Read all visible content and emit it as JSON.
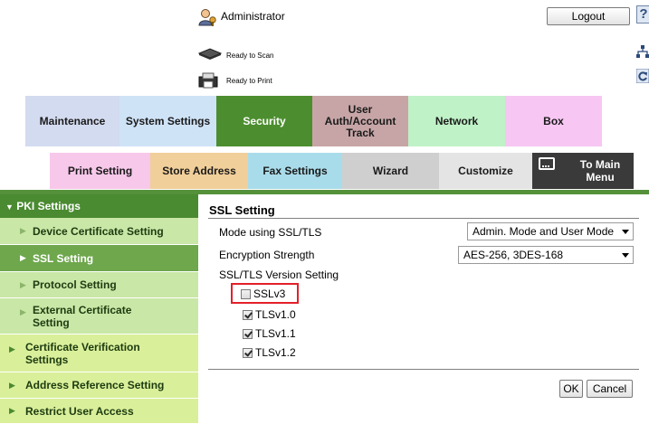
{
  "header": {
    "user_label": "Administrator",
    "logout_label": "Logout",
    "help_glyph": "?",
    "scan_status": "Ready to Scan",
    "print_status": "Ready to Print"
  },
  "main_tabs": [
    {
      "label": "Maintenance",
      "color": "#d3dbf0"
    },
    {
      "label": "System Settings",
      "color": "#cfe3f7"
    },
    {
      "label": "Security",
      "color": "#4c8e2f",
      "selected": true
    },
    {
      "label": "User Auth/Account Track",
      "color": "#c7a5a6"
    },
    {
      "label": "Network",
      "color": "#bff2c7"
    },
    {
      "label": "Box",
      "color": "#f7c6f3"
    }
  ],
  "sub_tabs": [
    {
      "label": "Print Setting",
      "color": "#f7c8ea"
    },
    {
      "label": "Store Address",
      "color": "#f1cf9a"
    },
    {
      "label": "Fax Settings",
      "color": "#a9dcea"
    },
    {
      "label": "Wizard",
      "color": "#cfcfcf"
    },
    {
      "label": "Customize",
      "color": "#e4e4e4"
    },
    {
      "label": "To Main Menu",
      "color": "#3a3a3a"
    }
  ],
  "sidebar": {
    "header": "PKI Settings",
    "items": [
      {
        "label": "Device Certificate Setting",
        "selected": false
      },
      {
        "label": "SSL Setting",
        "selected": true
      },
      {
        "label": "Protocol Setting",
        "selected": false
      },
      {
        "label": "External Certificate Setting",
        "selected": false
      }
    ],
    "top_items": [
      {
        "label": "Certificate Verification Settings"
      },
      {
        "label": "Address Reference Setting"
      },
      {
        "label": "Restrict User Access"
      }
    ]
  },
  "content": {
    "title": "SSL Setting",
    "mode_label": "Mode using SSL/TLS",
    "mode_value": "Admin. Mode and User Mode",
    "strength_label": "Encryption Strength",
    "strength_value": "AES-256, 3DES-168",
    "version_label": "SSL/TLS Version Setting",
    "versions": [
      {
        "label": "SSLv3",
        "checked": false
      },
      {
        "label": "TLSv1.0",
        "checked": true
      },
      {
        "label": "TLSv1.1",
        "checked": true
      },
      {
        "label": "TLSv1.2",
        "checked": true
      }
    ],
    "ok_label": "OK",
    "cancel_label": "Cancel"
  },
  "colors": {
    "accent_green": "#4c8e2f",
    "sidebar_item": "#c9e7a6",
    "sidebar_selected": "#6ea74c",
    "highlight": "#e3202a"
  },
  "icons": [
    "administrator-icon",
    "scanner-icon",
    "printer-icon",
    "help-icon",
    "sitemap-icon",
    "refresh-icon",
    "main-menu-icon"
  ]
}
